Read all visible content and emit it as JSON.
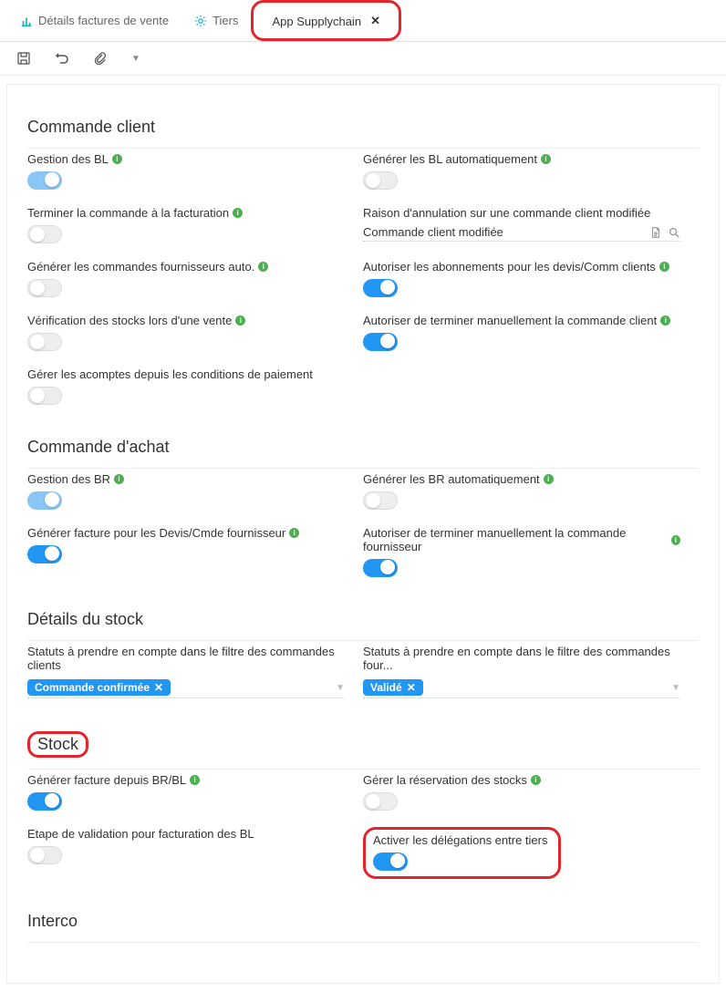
{
  "tabs": {
    "t1": "Détails factures de vente",
    "t2": "Tiers",
    "t3": "App Supplychain"
  },
  "sections": {
    "s1": "Commande client",
    "s2": "Commande d'achat",
    "s3": "Détails du stock",
    "s4": "Stock",
    "s5": "Interco"
  },
  "labels": {
    "gestion_bl": "Gestion des BL",
    "gen_bl_auto": "Générer les BL automatiquement",
    "terminer_fact": "Terminer la commande à la facturation",
    "raison_annul": "Raison d'annulation sur une commande client modifiée",
    "gen_cmd_four": "Générer les commandes fournisseurs auto.",
    "autor_abon": "Autoriser les abonnements pour les devis/Comm clients",
    "verif_stock": "Vérification des stocks lors d'une vente",
    "autor_term_cli": "Autoriser de terminer manuellement la commande client",
    "gerer_acomptes": "Gérer les acomptes depuis les conditions de paiement",
    "gestion_br": "Gestion des BR",
    "gen_br_auto": "Générer les BR automatiquement",
    "gen_fact_devis": "Générer facture pour les Devis/Cmde fournisseur",
    "autor_term_four": "Autoriser de terminer manuellement la commande fournisseur",
    "statuts_cli": "Statuts à prendre en compte dans le filtre des commandes clients",
    "statuts_four": "Statuts à prendre en compte dans le filtre des commandes four...",
    "gen_fact_brbl": "Générer facture depuis BR/BL",
    "gerer_reserv": "Gérer la réservation des stocks",
    "etape_valid": "Etape de validation pour facturation des BL",
    "activ_deleg": "Activer les délégations entre tiers"
  },
  "values": {
    "raison_annul_val": "Commande client modifiée",
    "tag_confirmee": "Commande confirmée",
    "tag_valide": "Validé"
  },
  "icons": {
    "info": "i"
  }
}
